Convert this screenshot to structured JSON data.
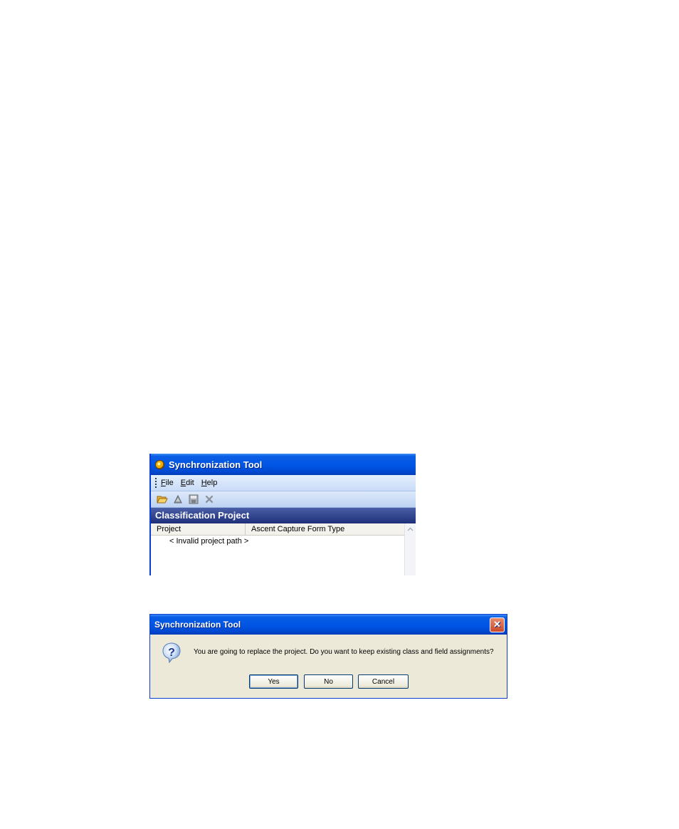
{
  "main_window": {
    "title": "Synchronization Tool",
    "menu": [
      "File",
      "Edit",
      "Help"
    ],
    "toolbar": [
      "open-folder-icon",
      "sync-icon",
      "save-icon",
      "delete-icon"
    ],
    "section_title": "Classification Project",
    "columns": [
      "Project",
      "Ascent Capture Form Type"
    ],
    "rows": [
      "< Invalid project path >"
    ]
  },
  "dialog": {
    "title": "Synchronization Tool",
    "icon": "question-icon",
    "message": "You are going to replace the project. Do you want to keep existing class and field assignments?",
    "buttons": {
      "yes": "Yes",
      "no": "No",
      "cancel": "Cancel"
    }
  },
  "colors": {
    "title_blue": "#0055e5",
    "section_navy": "#1e2f78",
    "dialog_bg": "#ece9d8"
  }
}
